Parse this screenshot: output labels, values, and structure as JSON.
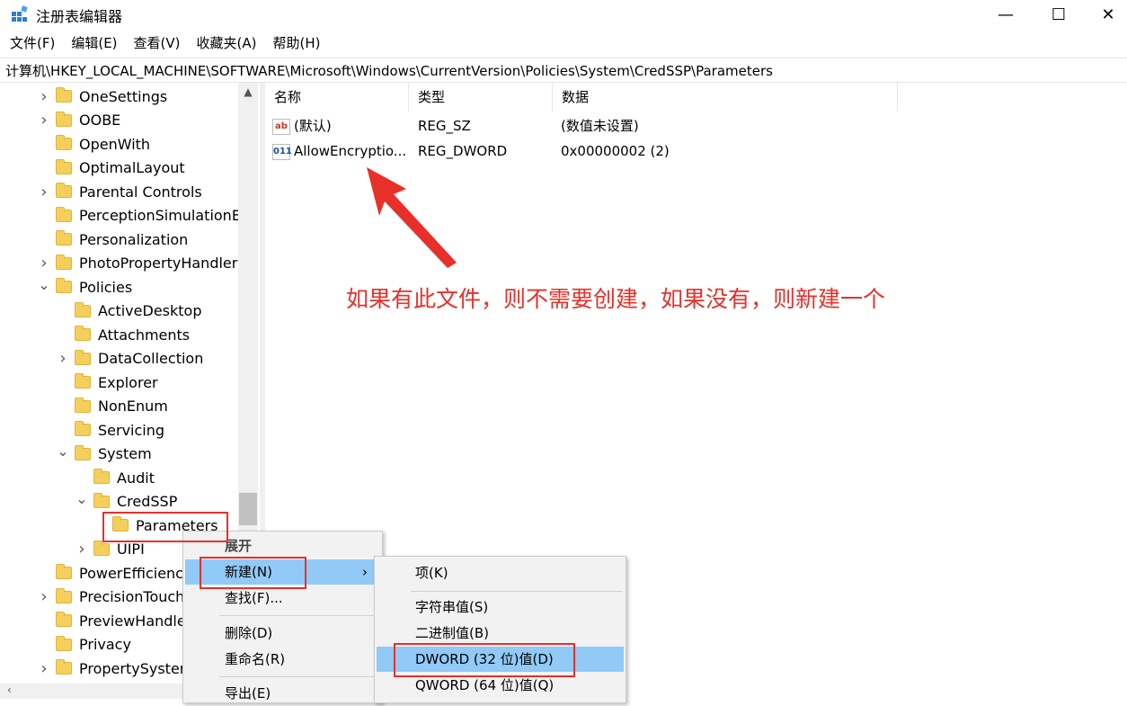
{
  "window": {
    "title": "注册表编辑器",
    "minimize": "—",
    "maximize": "☐",
    "close": "✕"
  },
  "menubar": [
    "文件(F)",
    "编辑(E)",
    "查看(V)",
    "收藏夹(A)",
    "帮助(H)"
  ],
  "address": "计算机\\HKEY_LOCAL_MACHINE\\SOFTWARE\\Microsoft\\Windows\\CurrentVersion\\Policies\\System\\CredSSP\\Parameters",
  "tree": {
    "items": [
      {
        "label": "OneSettings",
        "level": 0,
        "expander": ">"
      },
      {
        "label": "OOBE",
        "level": 0,
        "expander": ">"
      },
      {
        "label": "OpenWith",
        "level": 0,
        "expander": ""
      },
      {
        "label": "OptimalLayout",
        "level": 0,
        "expander": ""
      },
      {
        "label": "Parental Controls",
        "level": 0,
        "expander": ">"
      },
      {
        "label": "PerceptionSimulationEx",
        "level": 0,
        "expander": ""
      },
      {
        "label": "Personalization",
        "level": 0,
        "expander": ""
      },
      {
        "label": "PhotoPropertyHandler",
        "level": 0,
        "expander": ">"
      },
      {
        "label": "Policies",
        "level": 0,
        "expander": "v"
      },
      {
        "label": "ActiveDesktop",
        "level": 1,
        "expander": ""
      },
      {
        "label": "Attachments",
        "level": 1,
        "expander": ""
      },
      {
        "label": "DataCollection",
        "level": 1,
        "expander": ">"
      },
      {
        "label": "Explorer",
        "level": 1,
        "expander": ""
      },
      {
        "label": "NonEnum",
        "level": 1,
        "expander": ""
      },
      {
        "label": "Servicing",
        "level": 1,
        "expander": ""
      },
      {
        "label": "System",
        "level": 1,
        "expander": "v"
      },
      {
        "label": "Audit",
        "level": 2,
        "expander": ""
      },
      {
        "label": "CredSSP",
        "level": 2,
        "expander": "v"
      },
      {
        "label": "Parameters",
        "level": 3,
        "expander": ""
      },
      {
        "label": "UIPI",
        "level": 2,
        "expander": ">"
      },
      {
        "label": "PowerEfficiency",
        "level": 0,
        "expander": ""
      },
      {
        "label": "PrecisionTouchI",
        "level": 0,
        "expander": ">"
      },
      {
        "label": "PreviewHandler",
        "level": 0,
        "expander": ""
      },
      {
        "label": "Privacy",
        "level": 0,
        "expander": ""
      },
      {
        "label": "PropertySystem",
        "level": 0,
        "expander": ">"
      }
    ]
  },
  "list": {
    "headers": [
      "名称",
      "类型",
      "数据"
    ],
    "rows": [
      {
        "icon": "ab",
        "name": "(默认)",
        "type": "REG_SZ",
        "data": "(数值未设置)"
      },
      {
        "icon": "011",
        "name": "AllowEncryptio...",
        "type": "REG_DWORD",
        "data": "0x00000002 (2)"
      }
    ]
  },
  "annotation": "如果有此文件，则不需要创建，如果没有，则新建一个",
  "context_menu": {
    "items": [
      "展开",
      "新建(N)",
      "查找(F)...",
      "删除(D)",
      "重命名(R)",
      "导出(E)"
    ],
    "submenu_arrow": "›"
  },
  "submenu": {
    "items": [
      "项(K)",
      "字符串值(S)",
      "二进制值(B)",
      "DWORD (32 位)值(D)",
      "QWORD (64 位)值(Q)"
    ]
  },
  "colors": {
    "annotation_red": "#e8302a",
    "highlight": "#91c9f7",
    "folder": "#f5cf5b"
  }
}
